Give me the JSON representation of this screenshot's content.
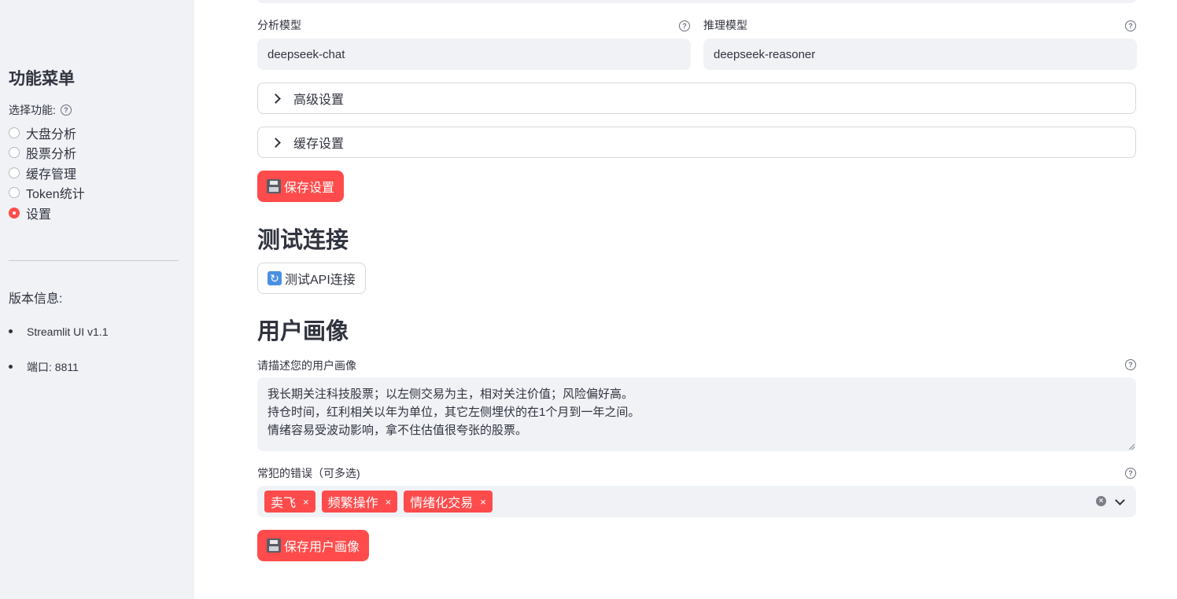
{
  "sidebar": {
    "title": "功能菜单",
    "select_label": "选择功能:",
    "options": [
      "大盘分析",
      "股票分析",
      "缓存管理",
      "Token统计",
      "设置"
    ],
    "selected": "设置",
    "version_label": "版本信息:",
    "version_items": [
      "Streamlit UI v1.1",
      "端口: 8811"
    ]
  },
  "settings": {
    "analysis_model_label": "分析模型",
    "analysis_model_value": "deepseek-chat",
    "reasoning_model_label": "推理模型",
    "reasoning_model_value": "deepseek-reasoner",
    "advanced_label": "高级设置",
    "cache_label": "缓存设置",
    "save_button": "保存设置"
  },
  "test": {
    "heading": "测试连接",
    "button": "测试API连接"
  },
  "profile": {
    "heading": "用户画像",
    "describe_label": "请描述您的用户画像",
    "describe_lines": [
      "我长期关注科技股票；以左侧交易为主，相对关注价值；风险偏好高。",
      "持仓时间，红利相关以年为单位，其它左侧埋伏的在1个月到一年之间。",
      "情绪容易受波动影响，拿不住估值很夸张的股票。"
    ],
    "mistakes_label": "常犯的错误（可多选)",
    "mistakes_selected": [
      "卖飞",
      "频繁操作",
      "情绪化交易"
    ],
    "tag_remove": "×",
    "save_button": "保存用户画像"
  },
  "icons": {
    "help": "?",
    "clear": "×",
    "refresh": "↻"
  },
  "colors": {
    "accent": "#ff4b4b",
    "sidebar_bg": "#f0f2f6",
    "text": "#31333f"
  }
}
